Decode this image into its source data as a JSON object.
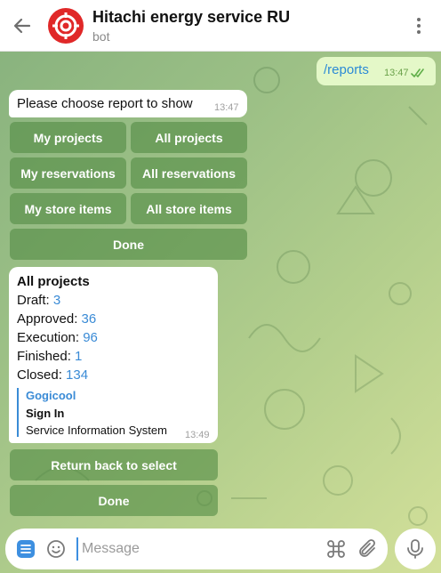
{
  "header": {
    "title": "Hitachi energy service RU",
    "subtitle": "bot"
  },
  "outgoing": {
    "text": "/reports",
    "time": "13:47"
  },
  "prompt": {
    "text": "Please choose report to show",
    "time": "13:47"
  },
  "keyboard_1": {
    "my_projects": "My projects",
    "all_projects": "All projects",
    "my_reservations": "My reservations",
    "all_reservations": "All reservations",
    "my_store_items": "My store items",
    "all_store_items": "All store items",
    "done": "Done"
  },
  "report": {
    "title": "All projects",
    "lines": [
      {
        "label": "Draft: ",
        "value": "3"
      },
      {
        "label": "Approved: ",
        "value": "36"
      },
      {
        "label": "Execution: ",
        "value": "96"
      },
      {
        "label": "Finished: ",
        "value": "1"
      },
      {
        "label": "Closed: ",
        "value": "134"
      }
    ],
    "quote": {
      "name": "Gogicool",
      "bold": "Sign In",
      "text": "Service Information System"
    },
    "time": "13:49"
  },
  "keyboard_2": {
    "return": "Return back to select",
    "done": "Done"
  },
  "composer": {
    "placeholder": "Message"
  },
  "colors": {
    "accent": "#3a8bd6",
    "avatar": "#e02828",
    "outgoing_bubble": "#e4f8c8"
  }
}
